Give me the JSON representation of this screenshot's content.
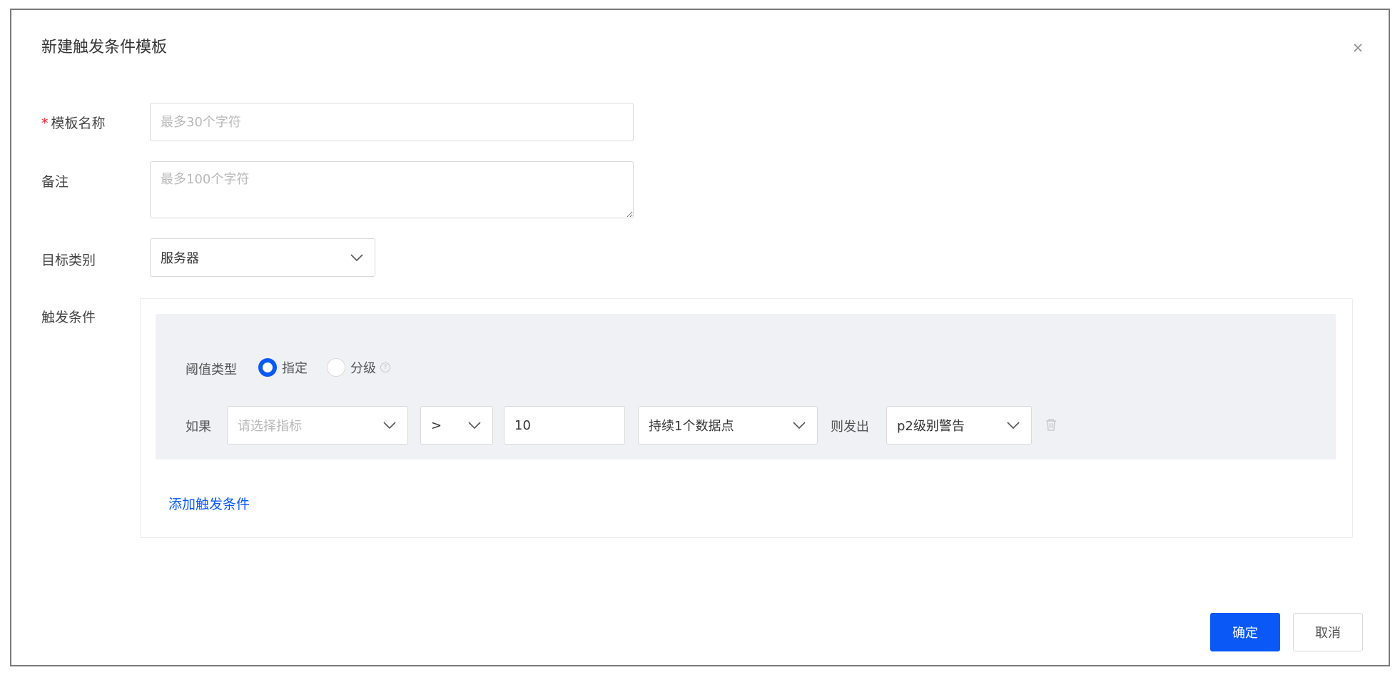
{
  "dialog": {
    "title": "新建触发条件模板",
    "close_icon": "close-icon"
  },
  "form": {
    "name": {
      "label": "模板名称",
      "required_mark": "*",
      "placeholder": "最多30个字符",
      "value": ""
    },
    "remark": {
      "label": "备注",
      "placeholder": "最多100个字符",
      "value": ""
    },
    "target": {
      "label": "目标类别",
      "value": "服务器"
    },
    "trigger": {
      "label": "触发条件",
      "threshold_label": "阈值类型",
      "options": [
        {
          "label": "指定",
          "checked": true
        },
        {
          "label": "分级",
          "checked": false
        }
      ],
      "rule": {
        "if_label": "如果",
        "metric_placeholder": "请选择指标",
        "operator": ">",
        "threshold_value": "10",
        "duration": "持续1个数据点",
        "then_label": "则发出",
        "alert_level": "p2级别警告"
      },
      "add_link": "添加触发条件"
    }
  },
  "footer": {
    "confirm": "确定",
    "cancel": "取消"
  },
  "colors": {
    "primary": "#0a59f7",
    "required": "#f5222d",
    "panel_bg": "#f0f1f5",
    "border": "#d9d9d9"
  }
}
